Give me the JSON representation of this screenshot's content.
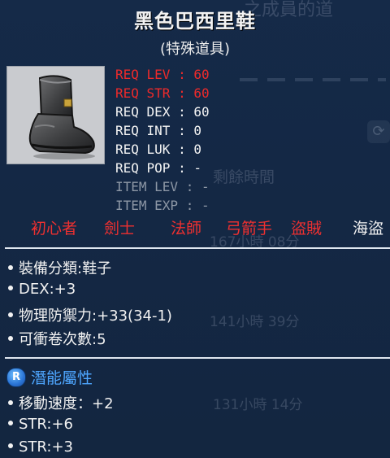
{
  "item": {
    "name": "黑色巴西里鞋",
    "type": "(特殊道具)",
    "icon": "boot-icon"
  },
  "requirements": [
    {
      "label": "REQ LEV",
      "value": "60",
      "status": "red"
    },
    {
      "label": "REQ STR",
      "value": "60",
      "status": "red"
    },
    {
      "label": "REQ DEX",
      "value": "60",
      "status": "ok"
    },
    {
      "label": "REQ INT",
      "value": "0",
      "status": "ok"
    },
    {
      "label": "REQ LUK",
      "value": "0",
      "status": "ok"
    },
    {
      "label": "REQ POP",
      "value": "-",
      "status": "ok"
    },
    {
      "label": "ITEM LEV",
      "value": "-",
      "status": "gray"
    },
    {
      "label": "ITEM EXP",
      "value": "-",
      "status": "gray"
    }
  ],
  "jobs": [
    {
      "name": "初心者",
      "status": "red"
    },
    {
      "name": "劍士",
      "status": "red"
    },
    {
      "name": "法師",
      "status": "red"
    },
    {
      "name": "弓箭手",
      "status": "red"
    },
    {
      "name": "盜賊",
      "status": "red"
    },
    {
      "name": "海盜",
      "status": "ok"
    }
  ],
  "stats": [
    "裝備分類:鞋子",
    "DEX:+3",
    "物理防禦力:+33(34-1)",
    "可衝卷次數:5"
  ],
  "potential": {
    "badge": "R",
    "title": "潛能屬性",
    "lines": [
      "移動速度：+2",
      "STR:+6",
      "STR:+3"
    ]
  },
  "background": {
    "title_fragment": "之成員的道",
    "remaining_time_label": "剩餘時間",
    "times": [
      "167小時 08分",
      "141小時 39分",
      "131小時 14分"
    ]
  },
  "colors": {
    "panel": "#142846",
    "requirement_unmet": "#ee2a2a",
    "requirement_met": "#f4f4f4",
    "requirement_na": "#8e98a6",
    "potential_rare": "#4ea6ff"
  }
}
